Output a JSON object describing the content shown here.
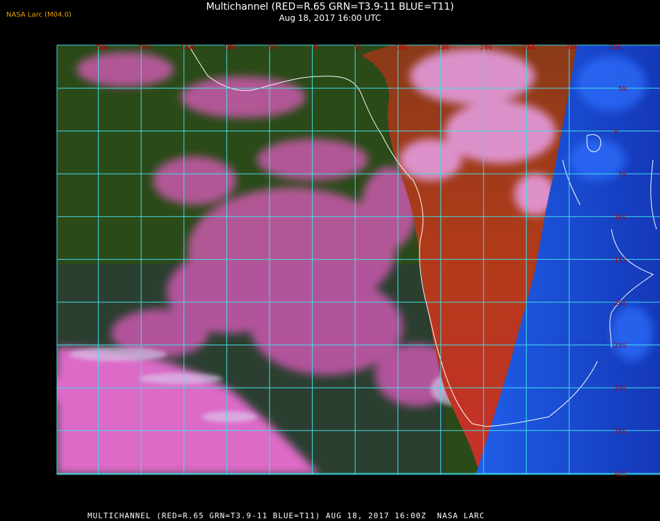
{
  "header": {
    "title": "Multichannel (RED=R.65 GRN=T3.9-11 BLUE=T11)",
    "subtitle": "Aug 18, 2017 16:00 UTC",
    "credit": "NASA Larc (M04.0)"
  },
  "footer": {
    "caption": "MULTICHANNEL (RED=R.65 GRN=T3.9-11 BLUE=T11) AUG 18, 2017 16:00Z  NASA LARC"
  },
  "grid": {
    "lon_labels": [
      "25W",
      "20W",
      "15W",
      "10W",
      "5W",
      "0",
      "5E",
      "10E",
      "15E",
      "20E",
      "25E",
      "30E",
      "35E"
    ],
    "lat_labels": [
      "5N",
      "0",
      "5S",
      "10S",
      "15S",
      "20S",
      "25S",
      "30S",
      "35S",
      "40S"
    ],
    "line_color": "#40e0e8",
    "label_color": "#c00000"
  },
  "colors": {
    "ocean_low_cloud": "#e060c0",
    "clear_ocean": "#2a4a18",
    "clear_land": "#b03818",
    "cold_cloud": "#1a50e0",
    "coastline": "#ffffff"
  }
}
